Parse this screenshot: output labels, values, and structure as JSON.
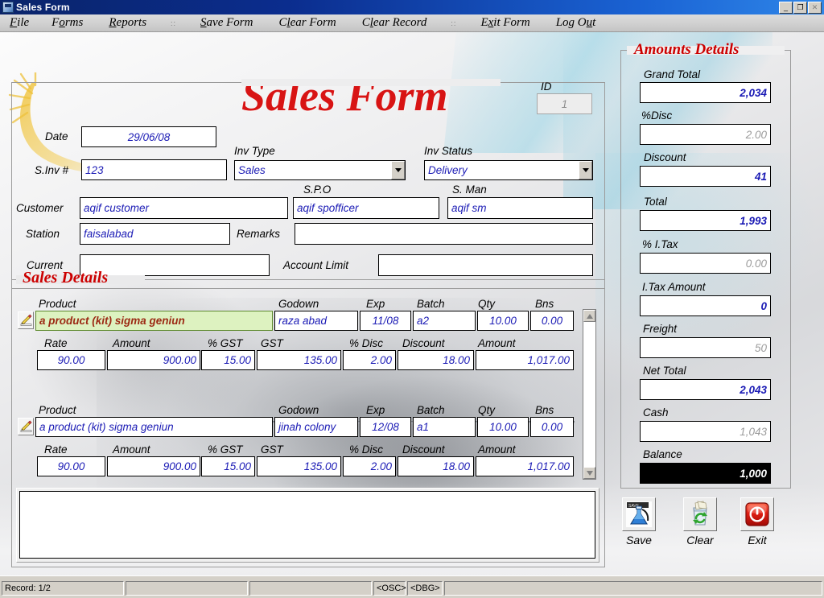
{
  "window": {
    "title": "Sales Form",
    "icon": "app-icon",
    "buttons": {
      "minimize": "_",
      "restore": "❐",
      "close": "✕"
    }
  },
  "menubar": {
    "items": [
      {
        "label": "File",
        "accel": "F",
        "pre": "",
        "post": "ile"
      },
      {
        "label": "Forms",
        "accel": "o",
        "pre": "F",
        "post": "rms"
      },
      {
        "label": "Reports",
        "accel": "R",
        "pre": "",
        "post": "eports"
      },
      {
        "label": "::",
        "separator": true
      },
      {
        "label": "Save Form",
        "accel": "S",
        "pre": "",
        "post": "ave Form"
      },
      {
        "label": "Clear Form",
        "accel": "l",
        "pre": "C",
        "post": "ear Form"
      },
      {
        "label": "Clear Record",
        "accel": "l",
        "pre": "C",
        "post": "ear Record"
      },
      {
        "label": "::",
        "separator": true
      },
      {
        "label": "Exit Form",
        "accel": "x",
        "pre": "E",
        "post": "it Form"
      },
      {
        "label": "Log Out",
        "accel": "u",
        "pre": "Log O",
        "post": "t"
      }
    ]
  },
  "form": {
    "title": "Sales Form",
    "header": {
      "date_label": "Date",
      "date_value": "29/06/08",
      "sinv_label": "S.Inv #",
      "sinv_value": "123",
      "inv_type_label": "Inv Type",
      "inv_type_value": "Sales",
      "inv_status_label": "Inv Status",
      "inv_status_value": "Delivery",
      "id_label": "ID",
      "id_value": "1",
      "customer_label": "Customer",
      "customer_value": "aqif customer",
      "spo_label": "S.P.O",
      "spo_value": "aqif spofficer",
      "sman_label": "S. Man",
      "sman_value": "aqif sm",
      "station_label": "Station",
      "station_value": "faisalabad",
      "remarks_label": "Remarks",
      "remarks_value": "",
      "current_label": "Current",
      "current_value": "",
      "account_limit_label": "Account Limit",
      "account_limit_value": ""
    }
  },
  "sales_details": {
    "legend": "Sales Details",
    "columns_top": [
      "Product",
      "Godown",
      "Exp",
      "Batch",
      "Qty",
      "Bns"
    ],
    "columns_bottom": [
      "Rate",
      "Amount",
      "% GST",
      "GST",
      "% Disc",
      "Discount",
      "Amount"
    ],
    "rows": [
      {
        "selected": true,
        "product": "a product (kit) sigma geniun",
        "godown": "raza abad",
        "exp": "11/08",
        "batch": "a2",
        "qty": "10.00",
        "bns": "0.00",
        "rate": "90.00",
        "amount": "900.00",
        "pct_gst": "15.00",
        "gst": "135.00",
        "pct_disc": "2.00",
        "discount": "18.00",
        "amount2": "1,017.00"
      },
      {
        "selected": false,
        "product": "a product (kit) sigma geniun",
        "godown": "jinah colony",
        "exp": "12/08",
        "batch": "a1",
        "qty": "10.00",
        "bns": "0.00",
        "rate": "90.00",
        "amount": "900.00",
        "pct_gst": "15.00",
        "gst": "135.00",
        "pct_disc": "2.00",
        "discount": "18.00",
        "amount2": "1,017.00"
      }
    ],
    "memo_value": ""
  },
  "amounts": {
    "legend": "Amounts Details",
    "fields": [
      {
        "label": "Grand Total",
        "value": "2,034",
        "state": "normal"
      },
      {
        "label": "%Disc",
        "value": "2.00",
        "state": "muted"
      },
      {
        "label": "Discount",
        "value": "41",
        "state": "normal"
      },
      {
        "label": "Total",
        "value": "1,993",
        "state": "normal"
      },
      {
        "label": "% I.Tax",
        "value": "0.00",
        "state": "muted"
      },
      {
        "label": "I.Tax Amount",
        "value": "0",
        "state": "normal"
      },
      {
        "label": "Freight",
        "value": "50",
        "state": "muted"
      },
      {
        "label": "Net Total",
        "value": "2,043",
        "state": "normal"
      },
      {
        "label": "Cash",
        "value": "1,043",
        "state": "muted"
      },
      {
        "label": "Balance",
        "value": "1,000",
        "state": "inverse"
      }
    ]
  },
  "actions": [
    {
      "label": "Save",
      "icon": "flask-icon"
    },
    {
      "label": "Clear",
      "icon": "recycle-bin-icon"
    },
    {
      "label": "Exit",
      "icon": "power-icon"
    }
  ],
  "statusbar": {
    "record": "Record: 1/2",
    "pane2": "",
    "pane3": "",
    "osc": "<OSC>",
    "dbg": "<DBG>",
    "pane6": ""
  },
  "colors": {
    "title_red": "#d81414",
    "legend_red": "#cc0000",
    "field_blue": "#1b1bb5",
    "selected_row_bg": "#ddf2c0",
    "selected_row_fg": "#9c2a14",
    "titlebar_blue": "#0a246a",
    "face": "#d4d0c8"
  }
}
